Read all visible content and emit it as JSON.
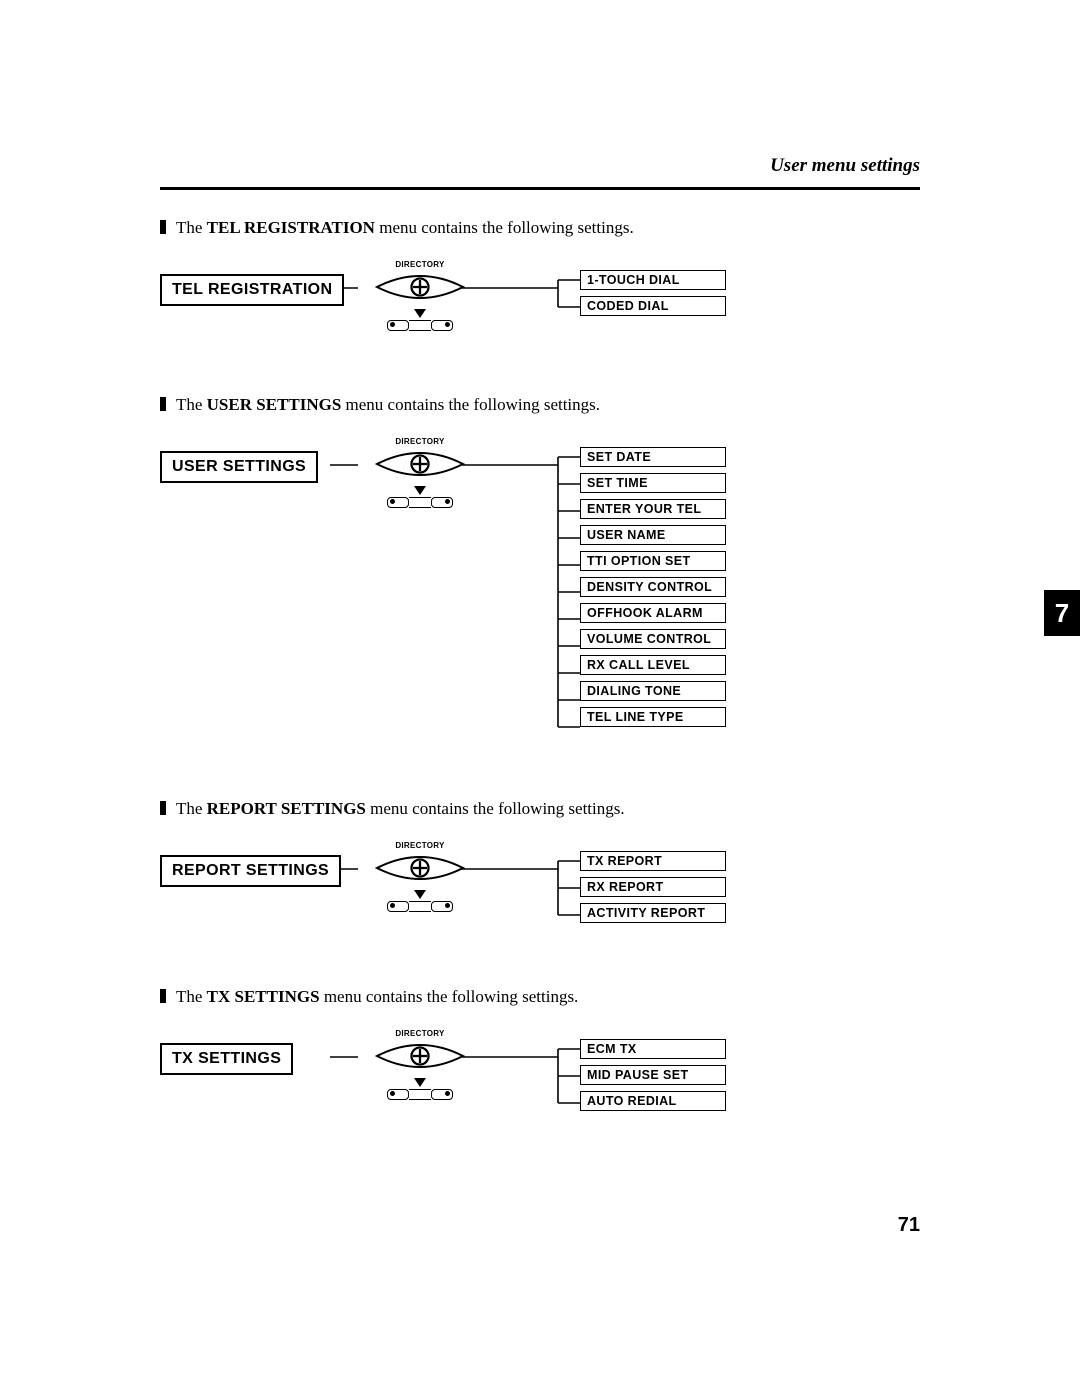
{
  "header": {
    "title": "User menu settings"
  },
  "sections": [
    {
      "intro_before": "The ",
      "intro_bold": "TEL REGISTRATION",
      "intro_after": " menu contains the following settings.",
      "menu_label": "TEL REGISTRATION",
      "lens_label": "DIRECTORY",
      "options": [
        "1-TOUCH DIAL",
        "CODED DIAL"
      ]
    },
    {
      "intro_before": "The ",
      "intro_bold": "USER SETTINGS",
      "intro_after": " menu contains the following settings.",
      "menu_label": "USER SETTINGS",
      "lens_label": "DIRECTORY",
      "options": [
        "SET DATE",
        "SET TIME",
        "ENTER YOUR TEL",
        "USER NAME",
        "TTI OPTION SET",
        "DENSITY CONTROL",
        "OFFHOOK ALARM",
        "VOLUME CONTROL",
        "RX CALL LEVEL",
        "DIALING TONE",
        "TEL LINE TYPE"
      ]
    },
    {
      "intro_before": "The ",
      "intro_bold": "REPORT SETTINGS",
      "intro_after": " menu contains the following settings.",
      "menu_label": "REPORT SETTINGS",
      "lens_label": "DIRECTORY",
      "options": [
        "TX REPORT",
        "RX REPORT",
        "ACTIVITY REPORT"
      ]
    },
    {
      "intro_before": "The ",
      "intro_bold": "TX SETTINGS",
      "intro_after": " menu contains the following settings.",
      "menu_label": "TX SETTINGS",
      "lens_label": "DIRECTORY",
      "options": [
        "ECM TX",
        "MID PAUSE SET",
        "AUTO REDIAL"
      ]
    }
  ],
  "side_tab": "7",
  "page_number": "71",
  "chart_data": [
    {
      "type": "table",
      "title": "TEL REGISTRATION menu",
      "categories": [
        "1-TOUCH DIAL",
        "CODED DIAL"
      ]
    },
    {
      "type": "table",
      "title": "USER SETTINGS menu",
      "categories": [
        "SET DATE",
        "SET TIME",
        "ENTER YOUR TEL",
        "USER NAME",
        "TTI OPTION SET",
        "DENSITY CONTROL",
        "OFFHOOK ALARM",
        "VOLUME CONTROL",
        "RX CALL LEVEL",
        "DIALING TONE",
        "TEL LINE TYPE"
      ]
    },
    {
      "type": "table",
      "title": "REPORT SETTINGS menu",
      "categories": [
        "TX REPORT",
        "RX REPORT",
        "ACTIVITY REPORT"
      ]
    },
    {
      "type": "table",
      "title": "TX SETTINGS menu",
      "categories": [
        "ECM TX",
        "MID PAUSE SET",
        "AUTO REDIAL"
      ]
    }
  ]
}
